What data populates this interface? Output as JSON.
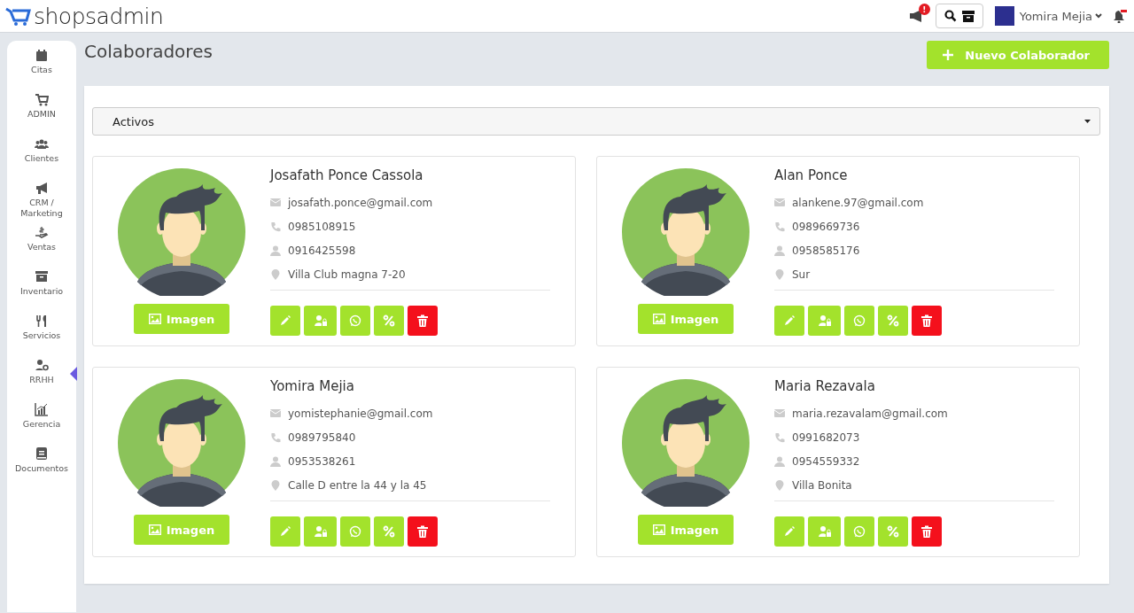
{
  "brand": {
    "name": "shopsadmin"
  },
  "topbar": {
    "alert_badge": "!",
    "user_name": "Yomira Mejia"
  },
  "sidebar": {
    "items": [
      {
        "kind": "calendar",
        "label": "Citas",
        "selected": false
      },
      {
        "kind": "cart",
        "label": "ADMIN",
        "selected": false
      },
      {
        "kind": "users",
        "label": "Clientes",
        "selected": false
      },
      {
        "kind": "megaphone",
        "label": "CRM / Marketing",
        "selected": false
      },
      {
        "kind": "money",
        "label": "Ventas",
        "selected": false
      },
      {
        "kind": "archive",
        "label": "Inventario",
        "selected": false
      },
      {
        "kind": "utensils",
        "label": "Servicios",
        "selected": false
      },
      {
        "kind": "usergear",
        "label": "RRHH",
        "selected": true
      },
      {
        "kind": "chart",
        "label": "Gerencia",
        "selected": false
      },
      {
        "kind": "book",
        "label": "Documentos",
        "selected": false
      }
    ]
  },
  "page": {
    "title": "Colaboradores",
    "new_button": "Nuevo Colaborador",
    "filter": {
      "value": "Activos"
    }
  },
  "collaborators": [
    {
      "name": "Josafath Ponce Cassola",
      "email": "josafath.ponce@gmail.com",
      "phone": "0985108915",
      "id_number": "0916425598",
      "address": "Villa Club magna 7-20",
      "image_button": "Imagen"
    },
    {
      "name": "Alan Ponce",
      "email": "alankene.97@gmail.com",
      "phone": "0989669736",
      "id_number": "0958585176",
      "address": "Sur",
      "image_button": "Imagen"
    },
    {
      "name": "Yomira Mejia",
      "email": "yomistephanie@gmail.com",
      "phone": "0989795840",
      "id_number": "0953538261",
      "address": "Calle D entre la 44 y la 45",
      "image_button": "Imagen"
    },
    {
      "name": "Maria Rezavala",
      "email": "maria.rezavalam@gmail.com",
      "phone": "0991682073",
      "id_number": "0954559332",
      "address": "Villa Bonita",
      "image_button": "Imagen"
    }
  ]
}
